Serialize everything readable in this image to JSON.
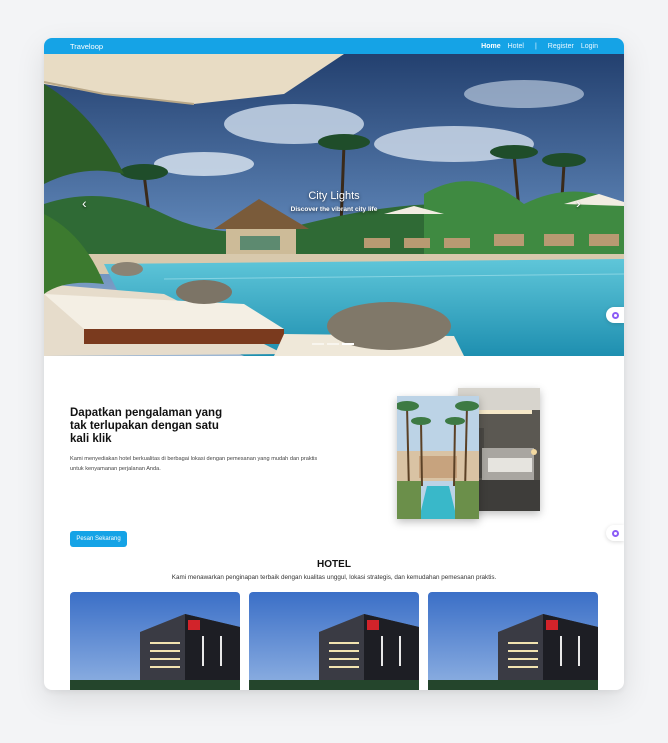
{
  "nav": {
    "brand": "Traveloop",
    "links": [
      "Home",
      "Hotel",
      "|",
      "Register",
      "Login"
    ]
  },
  "hero": {
    "title": "City Lights",
    "subtitle": "Discover the vibrant city life",
    "prev_icon": "chevron-left-icon",
    "next_icon": "chevron-right-icon",
    "slides_count": 3,
    "active_slide": 3
  },
  "about": {
    "title": "Dapatkan pengalaman yang tak terlupakan dengan satu kali klik",
    "text": "Kami menyediakan hotel berkualitas di berbagai lokasi dengan pemesanan yang mudah dan praktis untuk kenyamanan perjalanan Anda.",
    "button": "Pesan Sekarang"
  },
  "hotel_section": {
    "title": "HOTEL",
    "description": "Kami menawarkan penginapan terbaik dengan kualitas unggul, lokasi strategis, dan kemudahan pemesanan praktis."
  },
  "hotel_cards": [
    {
      "image": "hotel-building-photo"
    },
    {
      "image": "hotel-building-photo"
    },
    {
      "image": "hotel-building-photo"
    }
  ],
  "colors": {
    "primary": "#15a3e6",
    "text_dark": "#111111",
    "widget_accent": "#8b5cf6"
  }
}
